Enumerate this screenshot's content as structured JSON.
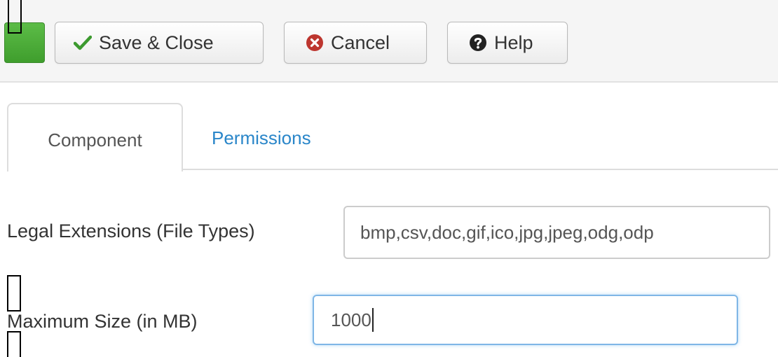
{
  "toolbar": {
    "save_close_label": "Save & Close",
    "cancel_label": "Cancel",
    "help_label": "Help"
  },
  "tabs": [
    {
      "label": "Component",
      "active": true
    },
    {
      "label": "Permissions",
      "active": false
    }
  ],
  "form": {
    "legal_extensions": {
      "label": "Legal Extensions (File Types)",
      "value": "bmp,csv,doc,gif,ico,jpg,jpeg,odg,odp"
    },
    "maximum_size": {
      "label": "Maximum Size (in MB)",
      "value": "1000"
    }
  },
  "icons": {
    "save": "check-icon",
    "cancel": "times-circle-icon",
    "help": "question-circle-icon"
  },
  "colors": {
    "save_check": "#3c9a2f",
    "cancel_icon": "#bd362f",
    "link": "#2a86c9",
    "focus_border": "#7fb6e6",
    "green_button": "#46a546"
  }
}
